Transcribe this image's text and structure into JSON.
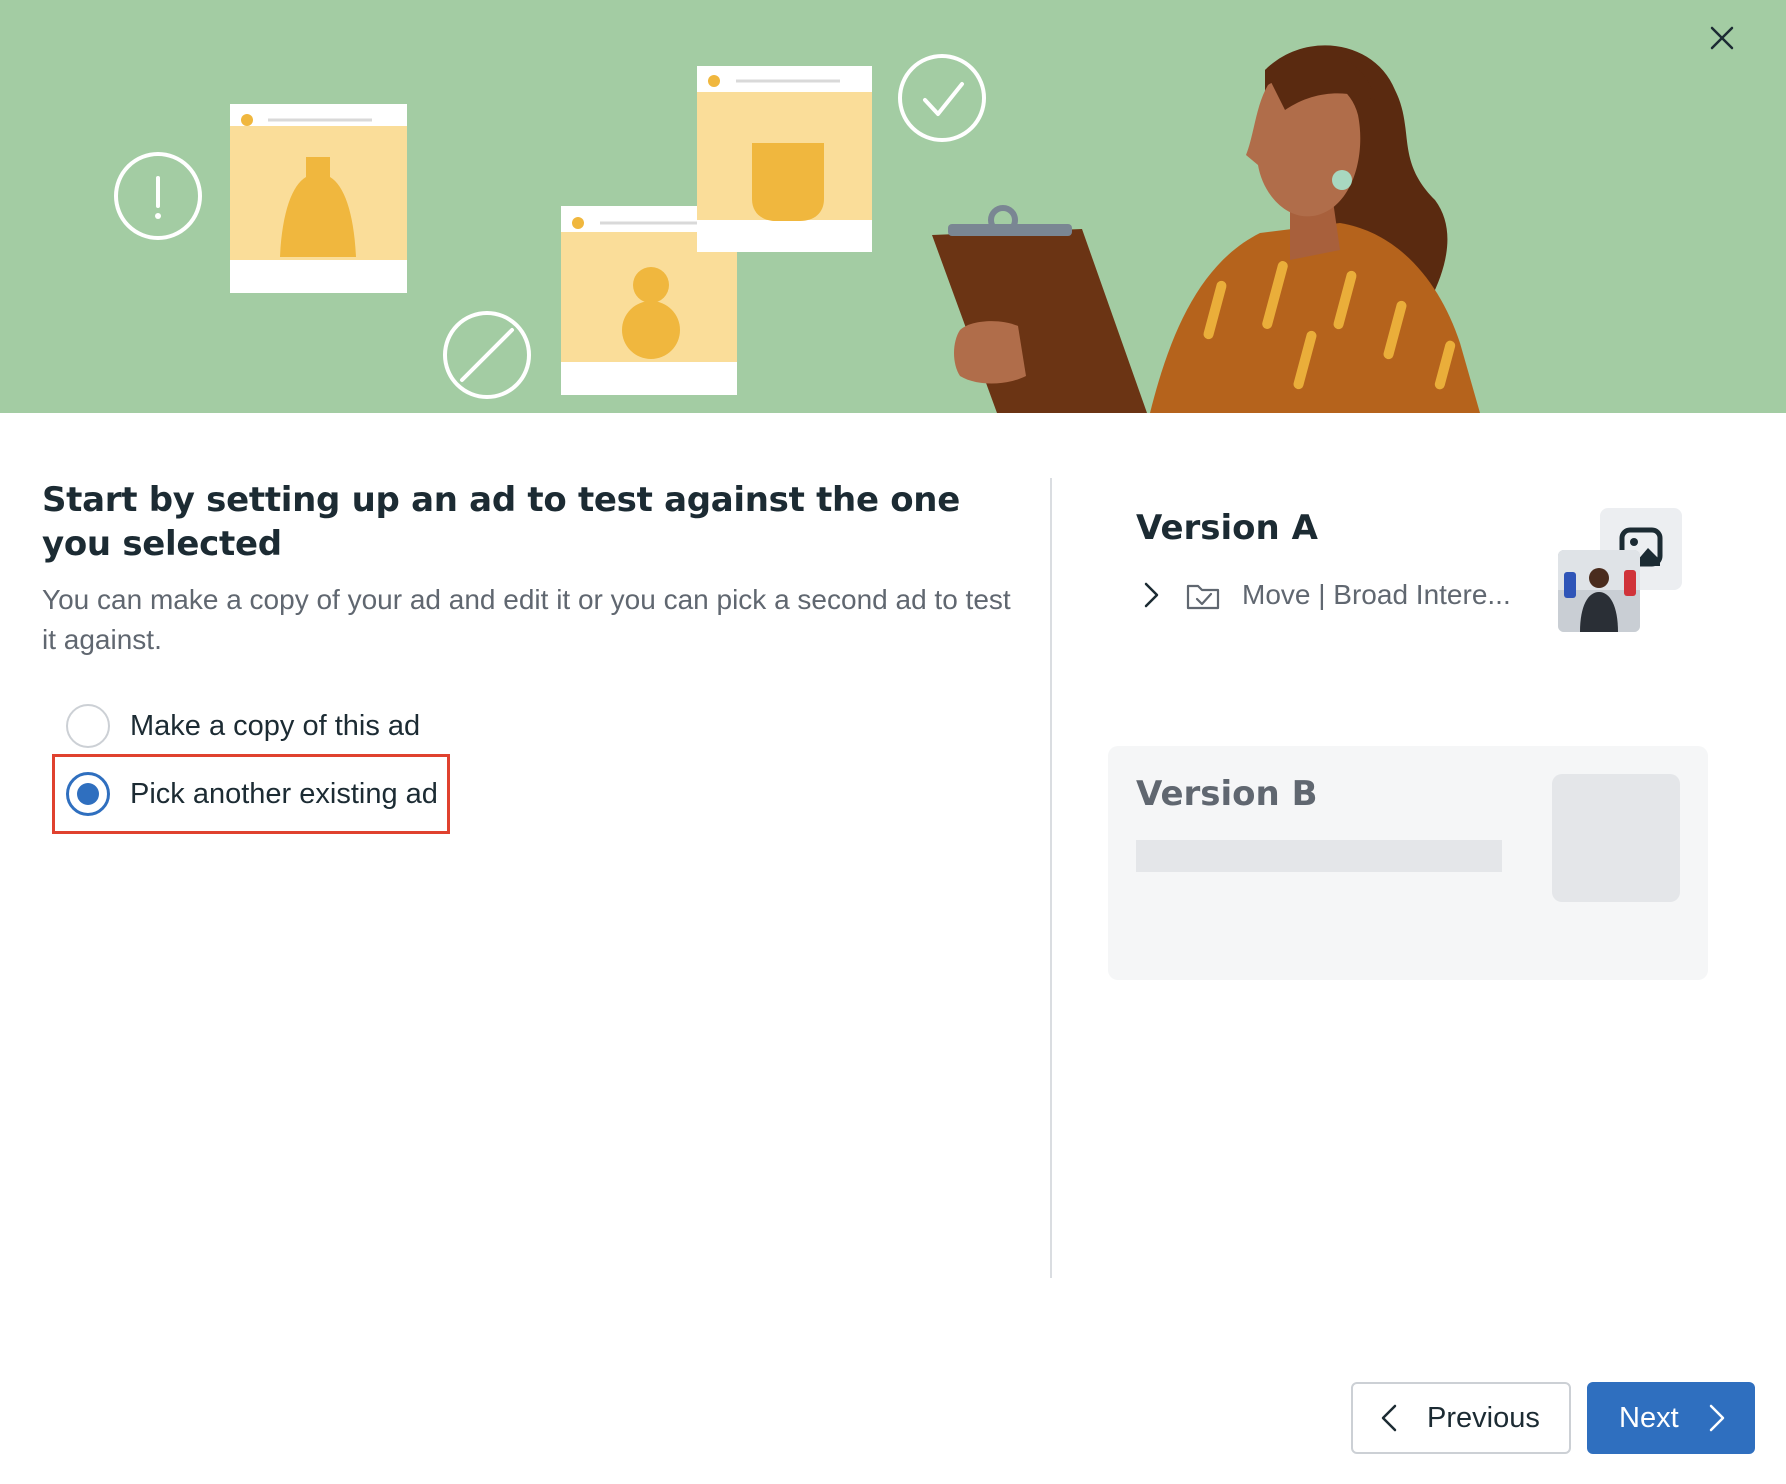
{
  "dialog": {
    "title": "Start by setting up an ad to test against the one you selected",
    "subtitle": "You can make a copy of your ad and edit it or you can pick a second ad to test it against.",
    "options": [
      {
        "label": "Make a copy of this ad",
        "checked": false
      },
      {
        "label": "Pick another existing ad",
        "checked": true
      }
    ]
  },
  "version_a": {
    "title": "Version A",
    "ad_name": "Move | Broad Intere..."
  },
  "version_b": {
    "title": "Version B"
  },
  "footer": {
    "previous_label": "Previous",
    "next_label": "Next"
  },
  "colors": {
    "hero_background": "#a3cca3",
    "primary_button": "#2f6fbf",
    "highlight_border": "#e0412f"
  },
  "icons": {
    "close": "close-icon",
    "chevron_left": "chevron-left-icon",
    "chevron_right": "chevron-right-icon",
    "ad_set": "folder-check-icon",
    "image_placeholder": "image-icon"
  }
}
